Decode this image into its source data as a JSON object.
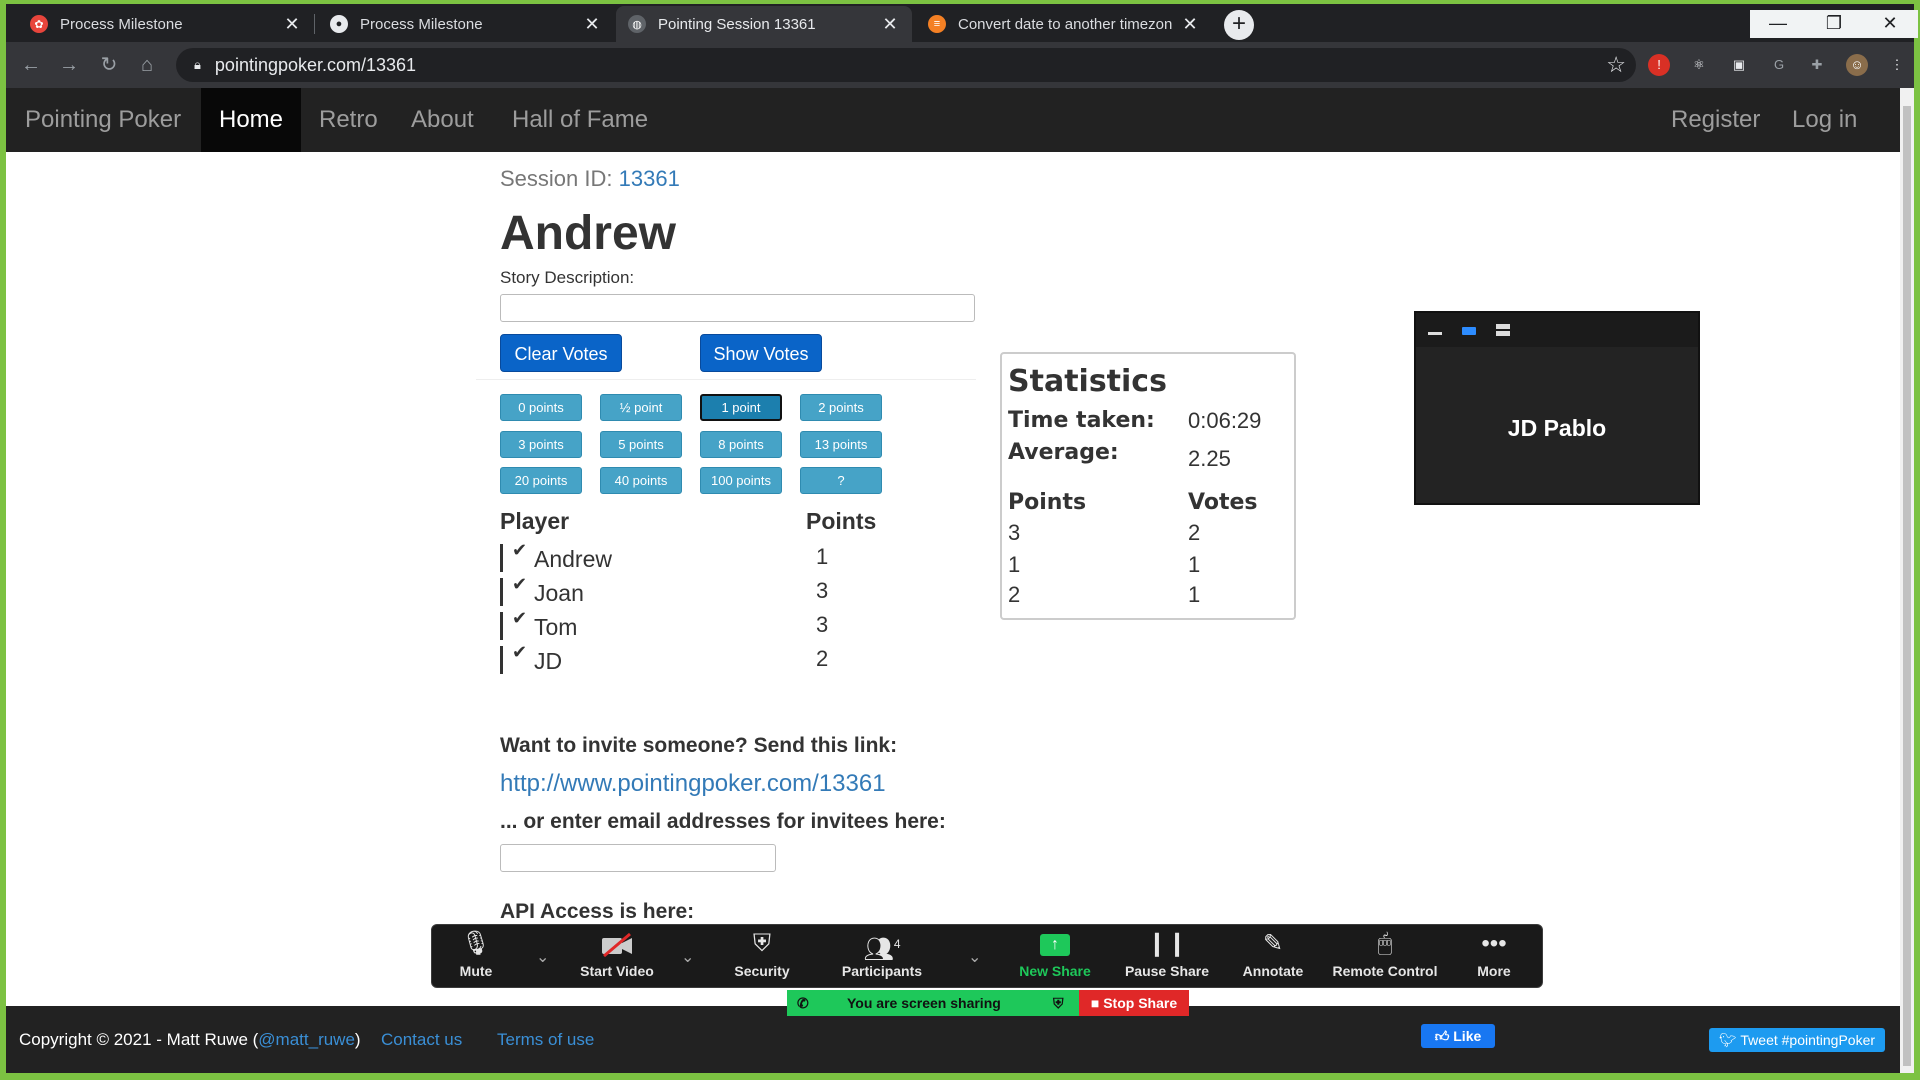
{
  "browser": {
    "tabs": [
      {
        "title": "Process Milestone",
        "favicon": "red-flower-icon",
        "active": false
      },
      {
        "title": "Process Milestone",
        "favicon": "github-icon",
        "active": false
      },
      {
        "title": "Pointing Session 13361",
        "favicon": "globe-icon",
        "active": true
      },
      {
        "title": "Convert date to another timezon",
        "favicon": "stackoverflow-icon",
        "active": false
      }
    ],
    "url": "pointingpoker.com/13361",
    "extension_badge": "1"
  },
  "nav": {
    "brand": "Pointing Poker",
    "items": [
      "Home",
      "Retro",
      "About",
      "Hall of Fame"
    ],
    "right_items": [
      "Register",
      "Log in"
    ]
  },
  "session": {
    "label": "Session ID:",
    "id": "13361"
  },
  "story": {
    "title": "Andrew",
    "description_label": "Story Description:",
    "description_value": ""
  },
  "actions": {
    "clear_votes": "Clear Votes",
    "show_votes": "Show Votes"
  },
  "point_buttons": [
    "0 points",
    "½ point",
    "1 point",
    "2 points",
    "3 points",
    "5 points",
    "8 points",
    "13 points",
    "20 points",
    "40 points",
    "100 points",
    "?"
  ],
  "selected_point": "1 point",
  "players": {
    "header_player": "Player",
    "header_points": "Points",
    "rows": [
      {
        "name": "Andrew",
        "points": "1"
      },
      {
        "name": "Joan",
        "points": "3"
      },
      {
        "name": "Tom",
        "points": "3"
      },
      {
        "name": "JD",
        "points": "2"
      }
    ]
  },
  "statistics": {
    "title": "Statistics",
    "time_taken_label": "Time taken:",
    "time_taken": "0:06:29",
    "average_label": "Average:",
    "average": "2.25",
    "points_header": "Points",
    "votes_header": "Votes",
    "rows": [
      {
        "points": "3",
        "votes": "2"
      },
      {
        "points": "1",
        "votes": "1"
      },
      {
        "points": "2",
        "votes": "1"
      }
    ]
  },
  "video_tile": {
    "name": "JD Pablo"
  },
  "invite": {
    "heading": "Want to invite someone? Send this link:",
    "link": "http://www.pointingpoker.com/13361",
    "email_heading": "... or enter email addresses for invitees here:",
    "email_value": ""
  },
  "api": {
    "heading": "API Access is here:"
  },
  "footer": {
    "copyright": "Copyright © 2021 - Matt Ruwe (",
    "handle": "@matt_ruwe",
    "copyright_end": ")",
    "contact": "Contact us",
    "terms": "Terms of use",
    "like": "Like",
    "tweet": "Tweet #pointingPoker"
  },
  "zoom": {
    "mute": "Mute",
    "start_video": "Start Video",
    "security": "Security",
    "participants": "Participants",
    "participants_count": "4",
    "new_share": "New Share",
    "pause_share": "Pause Share",
    "annotate": "Annotate",
    "remote_control": "Remote Control",
    "more": "More",
    "sharing_status": "You are screen sharing",
    "stop_share": "Stop Share",
    "accent_green": "#1ec85a",
    "stop_red": "#e02828"
  }
}
